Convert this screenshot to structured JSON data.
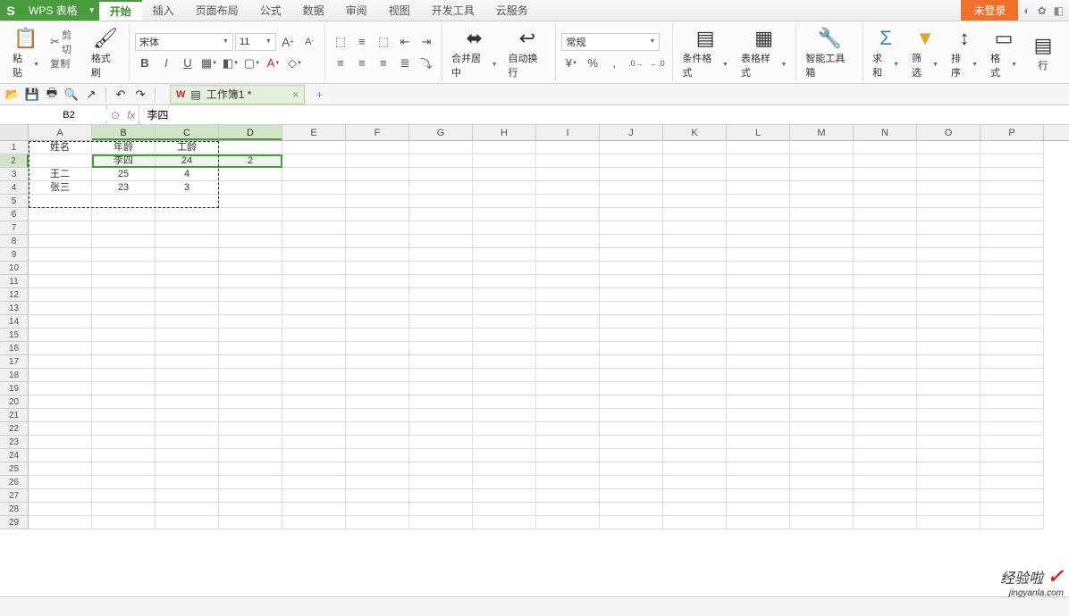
{
  "app": {
    "logo": "S",
    "name": "WPS 表格",
    "login": "未登录"
  },
  "tabs": [
    "开始",
    "插入",
    "页面布局",
    "公式",
    "数据",
    "审阅",
    "视图",
    "开发工具",
    "云服务"
  ],
  "active_tab": 0,
  "ribbon": {
    "paste": "粘贴",
    "cut": "剪切",
    "copy": "复制",
    "format_painter": "格式刷",
    "font": "宋体",
    "font_size": "11",
    "merge": "合并居中",
    "wrap": "自动换行",
    "number_format": "常规",
    "cond_format": "条件格式",
    "table_style": "表格样式",
    "smart_tools": "智能工具箱",
    "sum": "求和",
    "filter": "筛选",
    "sort": "排序",
    "format": "格式",
    "row": "行"
  },
  "doc_tab": "工作簿1 *",
  "name_box": "B2",
  "formula": "李四",
  "columns": [
    "A",
    "B",
    "C",
    "D",
    "E",
    "F",
    "G",
    "H",
    "I",
    "J",
    "K",
    "L",
    "M",
    "N",
    "O",
    "P"
  ],
  "rows": 29,
  "data": {
    "1": {
      "A": "姓名",
      "B": "年龄",
      "C": "工龄"
    },
    "2": {
      "B": "李四",
      "C": "24",
      "D": "2"
    },
    "3": {
      "A": "王二",
      "B": "25",
      "C": "4"
    },
    "4": {
      "A": "张三",
      "B": "23",
      "C": "3"
    }
  },
  "selection": {
    "from": {
      "r": 2,
      "c": 2
    },
    "to": {
      "r": 2,
      "c": 4
    },
    "active": {
      "r": 2,
      "c": 2
    }
  },
  "marching": {
    "from": {
      "r": 1,
      "c": 1
    },
    "to": {
      "r": 5,
      "c": 3
    }
  },
  "watermark": {
    "main": "经验啦",
    "check": "✓",
    "sub": "jingyanla.com"
  }
}
